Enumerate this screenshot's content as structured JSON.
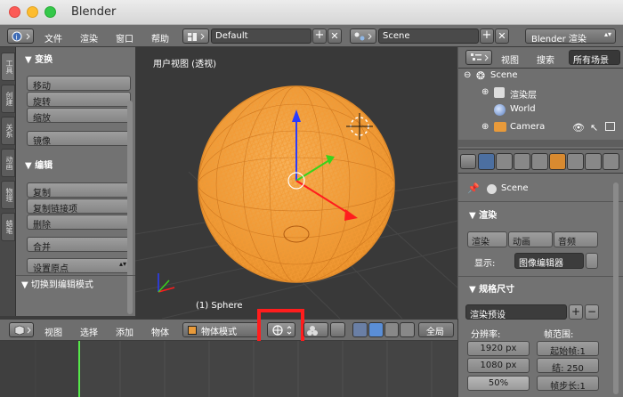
{
  "window": {
    "title": "Blender"
  },
  "info_header": {
    "menus": [
      "文件",
      "渲染",
      "窗口",
      "帮助"
    ],
    "screen_layout": "Default",
    "scene": "Scene",
    "render_engine": "Blender 渲染"
  },
  "left_tabs": [
    "工具",
    "创建",
    "关系",
    "动画",
    "物理",
    "蜡笔"
  ],
  "toolshelf": {
    "transform": {
      "title": "变换",
      "buttons": [
        "移动",
        "旋转",
        "缩放",
        "镜像"
      ]
    },
    "edit": {
      "title": "编辑",
      "buttons": [
        "复制",
        "复制链接项",
        "删除",
        "合并"
      ],
      "origin": "设置原点"
    },
    "operator": "切换到编辑模式"
  },
  "viewport": {
    "view_label": "用户视图 (透视)",
    "object_label": "(1) Sphere"
  },
  "outliner": {
    "view_menu": "视图",
    "search_menu": "搜索",
    "filter": "所有场景",
    "rows": [
      "Scene",
      "渲染层",
      "World",
      "Camera"
    ]
  },
  "properties": {
    "scene_name": "Scene",
    "render": {
      "title": "渲染",
      "buttons": [
        "渲染",
        "动画",
        "音频"
      ],
      "display_label": "显示:",
      "display_value": "图像编辑器"
    },
    "dimensions": {
      "title": "规格尺寸",
      "preset": "渲染预设",
      "resolution_label": "分辨率:",
      "res_x": "1920 px",
      "res_y": "1080 px",
      "res_pct": "50%",
      "frame_range_label": "帧范围:",
      "start": "起始帧:1",
      "end": "结:   250",
      "step": "帧步长:1"
    }
  },
  "view3d_header": {
    "menus": [
      "视图",
      "选择",
      "添加",
      "物体"
    ],
    "mode": "物体模式",
    "layer": "全局"
  },
  "colors": {
    "mesh": "#f39a34",
    "highlight": "#ff1d1d",
    "timeline_cursor": "#56e84a"
  }
}
